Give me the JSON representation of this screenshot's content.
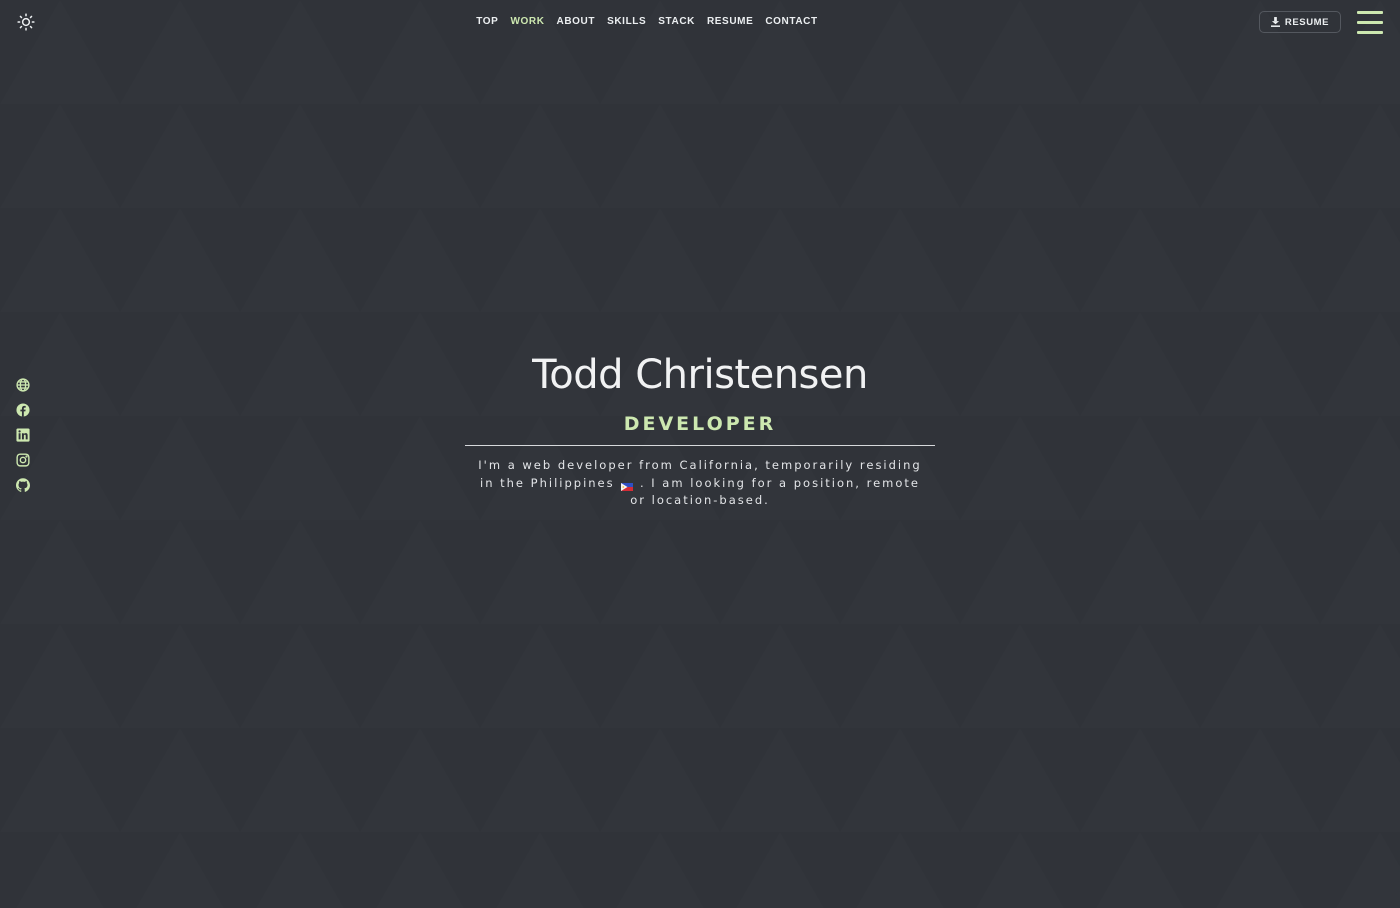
{
  "nav": {
    "items": [
      {
        "label": "TOP",
        "active": false
      },
      {
        "label": "WORK",
        "active": true
      },
      {
        "label": "ABOUT",
        "active": false
      },
      {
        "label": "SKILLS",
        "active": false
      },
      {
        "label": "STACK",
        "active": false
      },
      {
        "label": "RESUME",
        "active": false
      },
      {
        "label": "CONTACT",
        "active": false
      }
    ]
  },
  "header": {
    "theme_toggle_icon": "sun-icon",
    "resume_button": {
      "label": "RESUME",
      "icon": "download-icon"
    },
    "menu_icon": "hamburger-menu-icon"
  },
  "social": [
    {
      "name": "website",
      "icon": "globe-icon"
    },
    {
      "name": "facebook",
      "icon": "facebook-icon"
    },
    {
      "name": "linkedin",
      "icon": "linkedin-icon"
    },
    {
      "name": "instagram",
      "icon": "instagram-icon"
    },
    {
      "name": "github",
      "icon": "github-icon"
    }
  ],
  "hero": {
    "name": "Todd Christensen",
    "role": "DEVELOPER",
    "bio_part1": "I'm a web developer from California, temporarily residing in the Philippines",
    "bio_flag_icon": "philippines-flag-icon",
    "bio_part2": ". I am looking for a position, remote or location-based."
  },
  "colors": {
    "background": "#2f3238",
    "accent": "#cde8b0",
    "text": "#eceff1"
  }
}
